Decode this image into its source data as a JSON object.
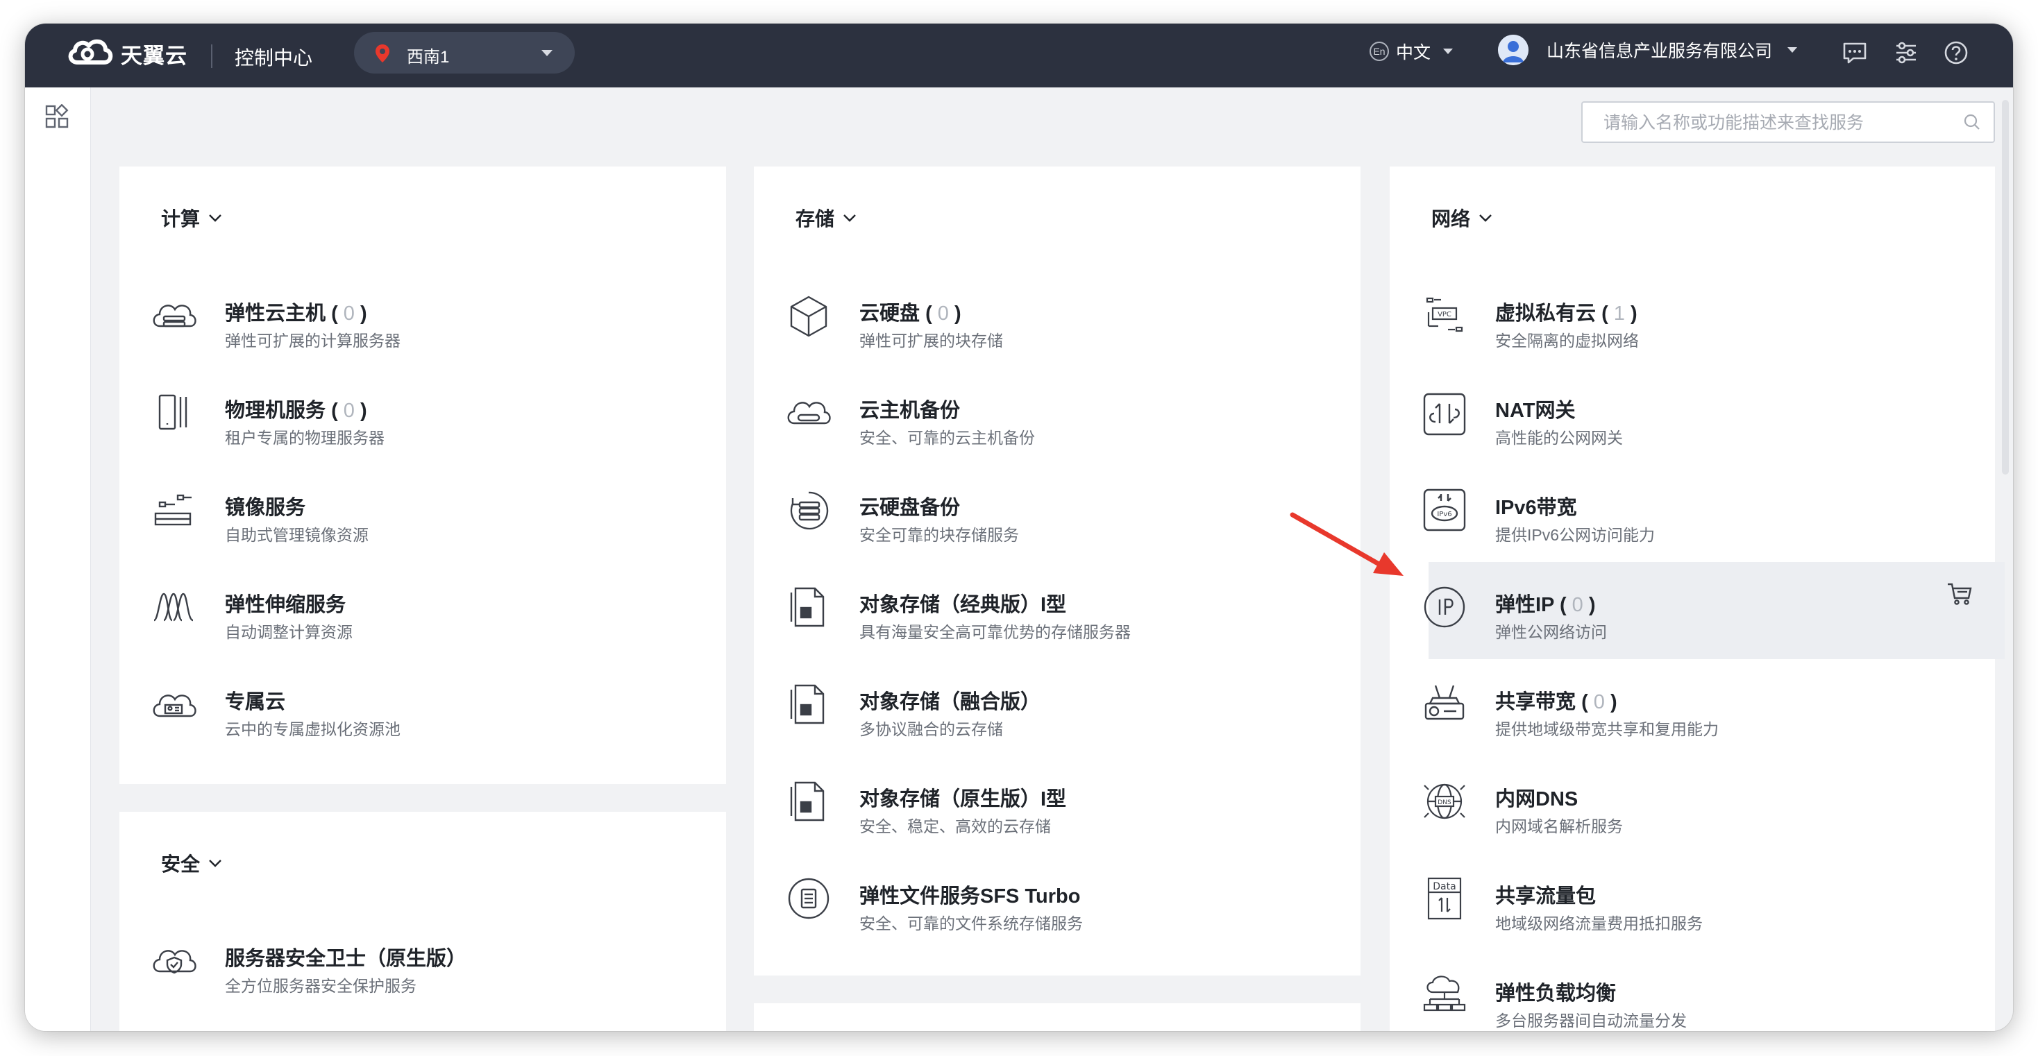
{
  "header": {
    "brand": "天翼云",
    "console_title": "控制中心",
    "region": "西南1",
    "language_badge": "En",
    "language": "中文",
    "account_name": "山东省信息产业服务有限公司"
  },
  "search": {
    "placeholder": "请输入名称或功能描述来查找服务"
  },
  "categories": [
    {
      "title": "计算",
      "items": [
        {
          "name": "弹性云主机",
          "count": "0",
          "desc": "弹性可扩展的计算服务器",
          "icon": "cloud-host-icon"
        },
        {
          "name": "物理机服务",
          "count": "0",
          "desc": "租户专属的物理服务器",
          "icon": "physical-machine-icon"
        },
        {
          "name": "镜像服务",
          "desc": "自助式管理镜像资源",
          "icon": "image-service-icon"
        },
        {
          "name": "弹性伸缩服务",
          "desc": "自动调整计算资源",
          "icon": "auto-scaling-icon"
        },
        {
          "name": "专属云",
          "desc": "云中的专属虚拟化资源池",
          "icon": "dedicated-cloud-icon"
        }
      ]
    },
    {
      "title": "安全",
      "items": [
        {
          "name": "服务器安全卫士（原生版）",
          "desc": "全方位服务器安全保护服务",
          "icon": "server-security-icon"
        }
      ]
    },
    {
      "title": "存储",
      "items": [
        {
          "name": "云硬盘",
          "count": "0",
          "desc": "弹性可扩展的块存储",
          "icon": "cloud-disk-icon"
        },
        {
          "name": "云主机备份",
          "desc": "安全、可靠的云主机备份",
          "icon": "host-backup-icon"
        },
        {
          "name": "云硬盘备份",
          "desc": "安全可靠的块存储服务",
          "icon": "disk-backup-icon"
        },
        {
          "name": "对象存储（经典版）I型",
          "desc": "具有海量安全高可靠优势的存储服务器",
          "icon": "object-storage-icon"
        },
        {
          "name": "对象存储（融合版）",
          "desc": "多协议融合的云存储",
          "icon": "object-storage-icon"
        },
        {
          "name": "对象存储（原生版）I型",
          "desc": "安全、稳定、高效的云存储",
          "icon": "object-storage-icon"
        },
        {
          "name": "弹性文件服务SFS Turbo",
          "desc": "安全、可靠的文件系统存储服务",
          "icon": "file-service-icon"
        }
      ]
    },
    {
      "title": "网络",
      "items": [
        {
          "name": "虚拟私有云",
          "count": "1",
          "desc": "安全隔离的虚拟网络",
          "icon": "vpc-icon"
        },
        {
          "name": "NAT网关",
          "desc": "高性能的公网网关",
          "icon": "nat-gateway-icon"
        },
        {
          "name": "IPv6带宽",
          "desc": "提供IPv6公网访问能力",
          "icon": "ipv6-icon"
        },
        {
          "name": "弹性IP",
          "count": "0",
          "desc": "弹性公网络访问",
          "icon": "elastic-ip-icon"
        },
        {
          "name": "共享带宽",
          "count": "0",
          "desc": "提供地域级带宽共享和复用能力",
          "icon": "shared-bandwidth-icon"
        },
        {
          "name": "内网DNS",
          "desc": "内网域名解析服务",
          "icon": "dns-icon"
        },
        {
          "name": "共享流量包",
          "desc": "地域级网络流量费用抵扣服务",
          "icon": "data-package-icon"
        },
        {
          "name": "弹性负载均衡",
          "desc": "多台服务器间自动流量分发",
          "icon": "load-balancer-icon"
        }
      ]
    }
  ],
  "colors": {
    "topbar": "#2c313f",
    "accent_arrow": "#e8382c",
    "pin": "#e8382c"
  }
}
